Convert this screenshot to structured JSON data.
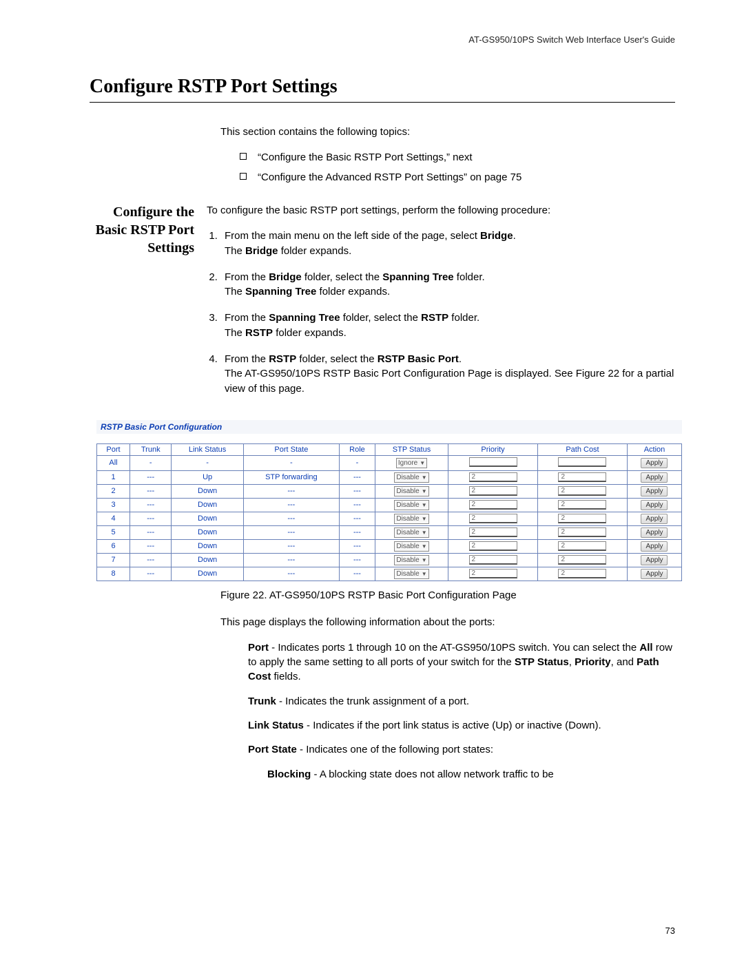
{
  "header": {
    "doc_title": "AT-GS950/10PS Switch Web Interface User's Guide"
  },
  "title": "Configure RSTP Port Settings",
  "intro": "This section contains the following topics:",
  "topics": [
    "“Configure the Basic RSTP Port Settings,”  next",
    "“Configure the Advanced RSTP Port Settings” on page 75"
  ],
  "side_heading": "Configure the Basic RSTP Port Settings",
  "lead_in": "To configure the basic RSTP port settings, perform the following procedure:",
  "steps": [
    {
      "pre": "From the main menu on the left side of the page, select ",
      "b1": "Bridge",
      "post1": ".",
      "nl": "The ",
      "b2": "Bridge",
      "post2": " folder expands."
    },
    {
      "pre": "From the ",
      "b1": "Bridge",
      "mid": " folder, select the ",
      "b2": "Spanning Tree",
      "post1": " folder.",
      "nl": "The ",
      "b3": "Spanning Tree",
      "post2": " folder expands."
    },
    {
      "pre": "From the ",
      "b1": "Spanning Tree",
      "mid": " folder, select the ",
      "b2": "RSTP",
      "post1": " folder.",
      "nl": "The ",
      "b3": "RSTP",
      "post2": " folder expands."
    },
    {
      "pre": "From the ",
      "b1": "RSTP",
      "mid": " folder, select the ",
      "b2": "RSTP Basic Port",
      "post1": ".",
      "nl": "The AT-GS950/10PS RSTP Basic Port Configuration Page is displayed. See Figure 22 for a partial view of this page."
    }
  ],
  "panel": {
    "title": "RSTP Basic Port Configuration",
    "columns": [
      "Port",
      "Trunk",
      "Link Status",
      "Port State",
      "Role",
      "STP Status",
      "Priority",
      "Path Cost",
      "Action"
    ],
    "rows": [
      {
        "port": "All",
        "trunk": "-",
        "link": "-",
        "state": "-",
        "role": "-",
        "stp": "Ignore",
        "priority": "",
        "cost": "",
        "action": "Apply"
      },
      {
        "port": "1",
        "trunk": "---",
        "link": "Up",
        "state": "STP forwarding",
        "role": "---",
        "stp": "Disable",
        "priority": "2",
        "cost": "2",
        "action": "Apply"
      },
      {
        "port": "2",
        "trunk": "---",
        "link": "Down",
        "state": "---",
        "role": "---",
        "stp": "Disable",
        "priority": "2",
        "cost": "2",
        "action": "Apply"
      },
      {
        "port": "3",
        "trunk": "---",
        "link": "Down",
        "state": "---",
        "role": "---",
        "stp": "Disable",
        "priority": "2",
        "cost": "2",
        "action": "Apply"
      },
      {
        "port": "4",
        "trunk": "---",
        "link": "Down",
        "state": "---",
        "role": "---",
        "stp": "Disable",
        "priority": "2",
        "cost": "2",
        "action": "Apply"
      },
      {
        "port": "5",
        "trunk": "---",
        "link": "Down",
        "state": "---",
        "role": "---",
        "stp": "Disable",
        "priority": "2",
        "cost": "2",
        "action": "Apply"
      },
      {
        "port": "6",
        "trunk": "---",
        "link": "Down",
        "state": "---",
        "role": "---",
        "stp": "Disable",
        "priority": "2",
        "cost": "2",
        "action": "Apply"
      },
      {
        "port": "7",
        "trunk": "---",
        "link": "Down",
        "state": "---",
        "role": "---",
        "stp": "Disable",
        "priority": "2",
        "cost": "2",
        "action": "Apply"
      },
      {
        "port": "8",
        "trunk": "---",
        "link": "Down",
        "state": "---",
        "role": "---",
        "stp": "Disable",
        "priority": "2",
        "cost": "2",
        "action": "Apply"
      }
    ]
  },
  "figure_caption": "Figure 22. AT-GS950/10PS RSTP Basic Port Configuration Page",
  "after_intro": "This page displays the following information about the ports:",
  "defs": {
    "port_label": "Port",
    "port_text_a": " - Indicates ports 1 through 10 on the AT-GS950/10PS switch. You can select the ",
    "port_all": "All",
    "port_text_b": " row to apply the same setting to all ports of your switch for the ",
    "port_f1": "STP Status",
    "port_c": ", ",
    "port_f2": "Priority",
    "port_d": ", and ",
    "port_f3": "Path Cost",
    "port_e": " fields.",
    "trunk_label": "Trunk",
    "trunk_text": " - Indicates the trunk assignment of a port.",
    "link_label": "Link Status",
    "link_text": " - Indicates if the port link status is active (Up) or inactive (Down).",
    "state_label": "Port State",
    "state_text": " - Indicates one of the following port states:",
    "block_label": "Blocking",
    "block_text": " - A blocking state does not allow network traffic to be"
  },
  "page_number": "73"
}
